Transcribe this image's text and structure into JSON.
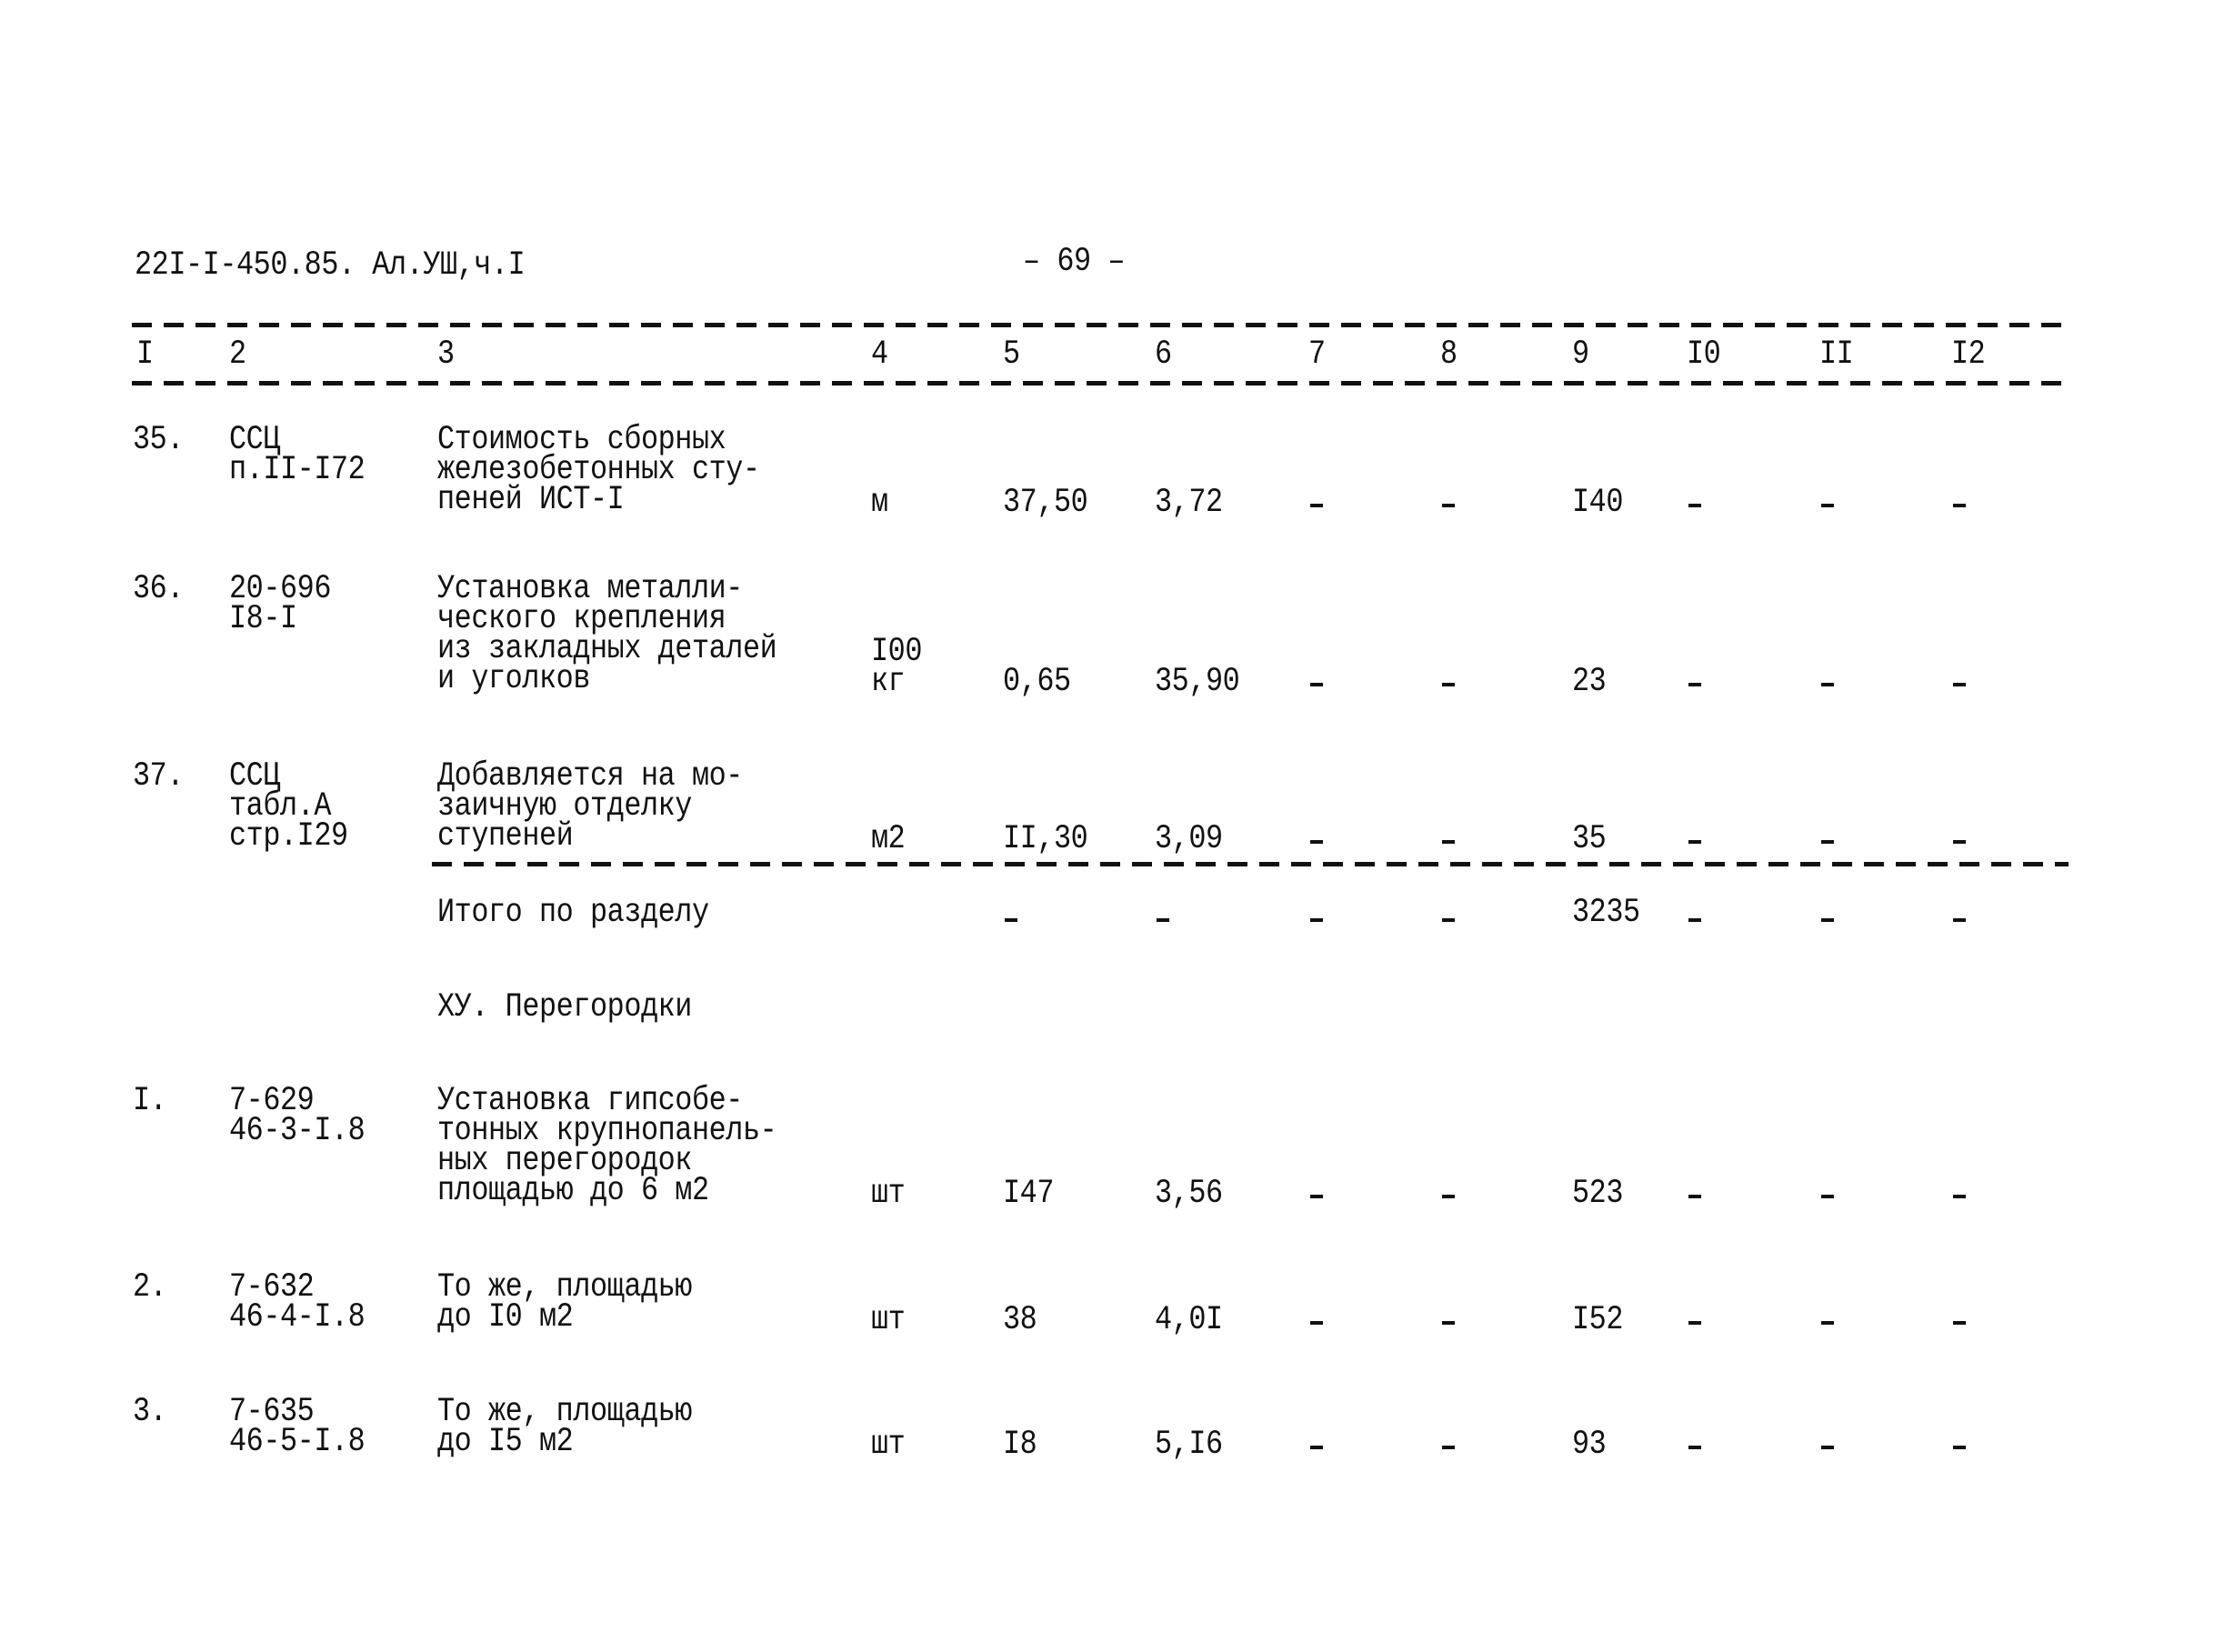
{
  "page_header": {
    "document_code": "22I-I-450.85. Ал.УШ,ч.I",
    "page_number": "– 69 –"
  },
  "table": {
    "columns": [
      "I",
      "2",
      "3",
      "4",
      "5",
      "6",
      "7",
      "8",
      "9",
      "I0",
      "II",
      "I2"
    ],
    "rows": [
      {
        "num": "35.",
        "code": [
          "ССЦ",
          "п.II-I72"
        ],
        "description": [
          "Стоимость сборных",
          "железобетонных сту-",
          "пеней ИСТ-I"
        ],
        "unit": [
          "м"
        ],
        "c5": "37,50",
        "c6": "3,72",
        "c7": "–",
        "c8": "–",
        "c9": "I40",
        "c10": "–",
        "c11": "–",
        "c12": "–"
      },
      {
        "num": "36.",
        "code": [
          "20-696",
          "I8-I"
        ],
        "description": [
          "Установка металли-",
          "ческого крепления",
          "из закладных деталей",
          "и уголков"
        ],
        "unit": [
          "I00",
          "кг"
        ],
        "c5": "0,65",
        "c6": "35,90",
        "c7": "–",
        "c8": "–",
        "c9": "23",
        "c10": "–",
        "c11": "–",
        "c12": "–"
      },
      {
        "num": "37.",
        "code": [
          "ССЦ",
          "табл.А",
          "стр.I29"
        ],
        "description": [
          "Добавляется на мо-",
          "заичную отделку",
          "ступеней"
        ],
        "unit": [
          "м2"
        ],
        "c5": "II,30",
        "c6": "3,09",
        "c7": "–",
        "c8": "–",
        "c9": "35",
        "c10": "–",
        "c11": "–",
        "c12": "–"
      }
    ],
    "subtotal": {
      "label": "Итого по разделу",
      "c5": "–",
      "c6": "–",
      "c7": "–",
      "c8": "–",
      "c9": "3235",
      "c10": "–",
      "c11": "–",
      "c12": "–"
    },
    "section_title": "ХУ. Перегородки",
    "section_rows": [
      {
        "num": "I.",
        "code": [
          "7-629",
          "46-3-I.8"
        ],
        "description": [
          "Установка гипсобе-",
          "тонных крупнопанель-",
          "ных перегородок",
          "площадью до 6 м2"
        ],
        "unit": [
          "шт"
        ],
        "c5": "I47",
        "c6": "3,56",
        "c7": "–",
        "c8": "–",
        "c9": "523",
        "c10": "–",
        "c11": "–",
        "c12": "–"
      },
      {
        "num": "2.",
        "code": [
          "7-632",
          "46-4-I.8"
        ],
        "description": [
          "То же, площадью",
          "до I0 м2"
        ],
        "unit": [
          "шт"
        ],
        "c5": "38",
        "c6": "4,0I",
        "c7": "–",
        "c8": "–",
        "c9": "I52",
        "c10": "–",
        "c11": "–",
        "c12": "–"
      },
      {
        "num": "3.",
        "code": [
          "7-635",
          "46-5-I.8"
        ],
        "description": [
          "То же, площадью",
          "до I5 м2"
        ],
        "unit": [
          "шт"
        ],
        "c5": "I8",
        "c6": "5,I6",
        "c7": "–",
        "c8": "–",
        "c9": "93",
        "c10": "–",
        "c11": "–",
        "c12": "–"
      }
    ]
  }
}
